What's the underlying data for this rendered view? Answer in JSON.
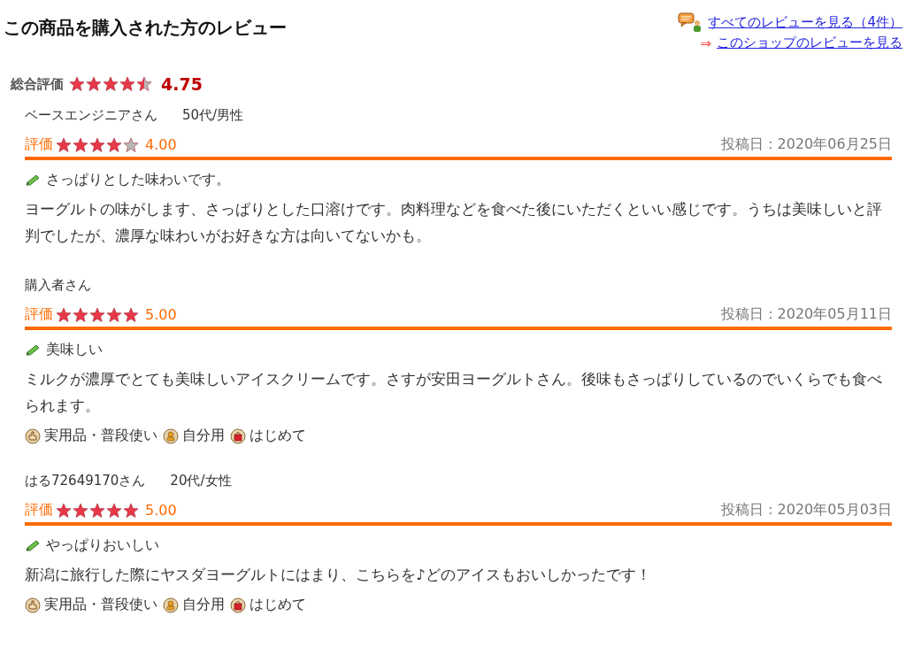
{
  "heading": "この商品を購入された方のレビュー",
  "links": [
    {
      "text": "すべてのレビューを見る（4件）",
      "kind": "all"
    },
    {
      "prefix": "⇒",
      "text": "このショップのレビューを見る",
      "kind": "shop"
    }
  ],
  "overall": {
    "label": "総合評価",
    "stars": 4.5,
    "score": "4.75"
  },
  "reviews": [
    {
      "reviewer": "ベースエンジニアさん",
      "profile": "50代/男性",
      "rating_label": "評価",
      "stars": 4,
      "score": "4.00",
      "date": "投稿日：2020年06月25日",
      "title": "さっぱりとした味わいです。",
      "body": "ヨーグルトの味がします、さっぱりとした口溶けです。肉料理などを食べた後にいただくといい感じです。うちは美味しいと評判でしたが、濃厚な味わいがお好きな方は向いてないかも。"
    },
    {
      "reviewer": "購入者さん",
      "rating_label": "評価",
      "stars": 5,
      "score": "5.00",
      "date": "投稿日：2020年05月11日",
      "title": "美味しい",
      "body": "ミルクが濃厚でとても美味しいアイスクリームです。さすが安田ヨーグルトさん。後味もさっぱりしているのでいくらでも食べられます。",
      "tags": [
        {
          "kind": "use",
          "text": "実用品・普段使い"
        },
        {
          "kind": "person",
          "text": "自分用"
        },
        {
          "kind": "bag",
          "text": "はじめて"
        }
      ]
    },
    {
      "reviewer": "はる72649170さん",
      "profile": "20代/女性",
      "rating_label": "評価",
      "stars": 5,
      "score": "5.00",
      "date": "投稿日：2020年05月03日",
      "title": "やっぱりおいしい",
      "body": "新潟に旅行した際にヤスダヨーグルトにはまり、こちらを♪どのアイスもおいしかったです！",
      "tags": [
        {
          "kind": "use",
          "text": "実用品・普段使い"
        },
        {
          "kind": "person",
          "text": "自分用"
        },
        {
          "kind": "bag",
          "text": "はじめて"
        }
      ]
    }
  ]
}
